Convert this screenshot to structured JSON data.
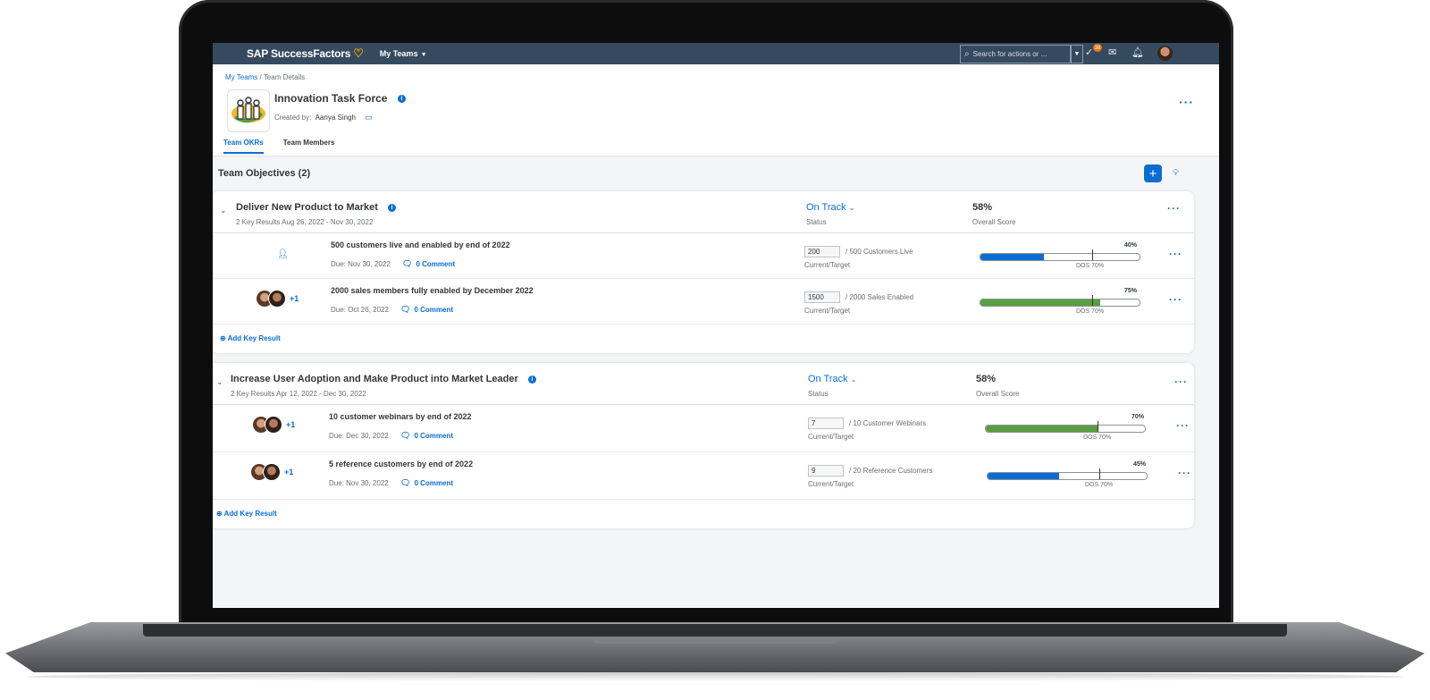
{
  "shell": {
    "logo": "SAP SuccessFactors",
    "logo_mark": "♡",
    "menu": "My Teams",
    "search_placeholder": "Search for actions or ...",
    "notification_count": "38"
  },
  "header": {
    "breadcrumb_link": "My Teams",
    "breadcrumb_sep": "/",
    "breadcrumb_current": "Team Details",
    "team_name": "Innovation Task Force",
    "created_label": "Created by:",
    "created_by": "Aanya Singh",
    "tabs": [
      "Team OKRs",
      "Team Members"
    ]
  },
  "section": {
    "title": "Team Objectives (2)"
  },
  "labels": {
    "status": "Status",
    "overall_score": "Overall Score",
    "current_target": "Current/Target",
    "add_key_result": "Add Key Result"
  },
  "objectives": [
    {
      "title": "Deliver New Product to Market",
      "meta": "2 Key Results  Aug 26, 2022 - Nov 30, 2022",
      "status": "On Track",
      "score": "58%",
      "key_results": [
        {
          "title": "500 customers live and enabled by end of 2022",
          "due": "Due: Nov 30, 2022",
          "comment": "0 Comment",
          "current": "200",
          "target": "/ 500 Customers Live",
          "progress": 40,
          "progress_label": "40%",
          "dos": "DOS 70%",
          "color": "#0a6ed1",
          "owners": "none"
        },
        {
          "title": "2000 sales members fully enabled by December 2022",
          "due": "Due: Oct 26, 2022",
          "comment": "0 Comment",
          "current": "1500",
          "target": "/ 2000 Sales Enabled",
          "progress": 75,
          "progress_label": "75%",
          "dos": "DOS 70%",
          "color": "#5a9e42",
          "owners_extra": "+1"
        }
      ]
    },
    {
      "title": "Increase User Adoption and Make Product into Market Leader",
      "meta": "2 Key Results  Apr 12, 2022 - Dec 30, 2022",
      "status": "On Track",
      "score": "58%",
      "key_results": [
        {
          "title": "10 customer webinars by end of 2022",
          "due": "Due: Dec 30, 2022",
          "comment": "0 Comment",
          "current": "7",
          "target": "/ 10 Customer Webinars",
          "progress": 70,
          "progress_label": "70%",
          "dos": "DOS 70%",
          "color": "#5a9e42",
          "owners_extra": "+1"
        },
        {
          "title": "5 reference customers by end of 2022",
          "due": "Due: Nov 30, 2022",
          "comment": "0 Comment",
          "current": "9",
          "target": "/ 20 Reference Customers",
          "progress": 45,
          "progress_label": "45%",
          "dos": "DOS 70%",
          "color": "#0a6ed1",
          "owners_extra": "+1"
        }
      ]
    }
  ]
}
